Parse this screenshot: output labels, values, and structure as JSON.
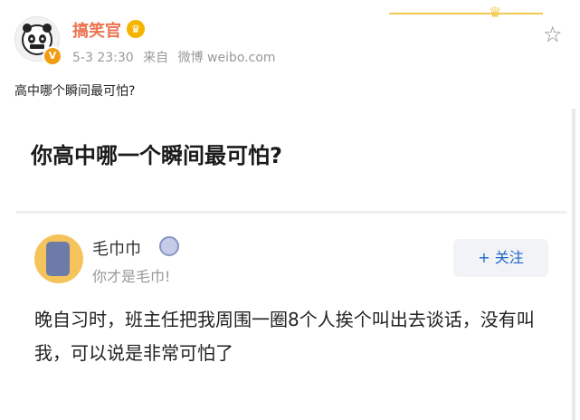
{
  "post": {
    "username": "搞笑官",
    "date": "5-3 23:30",
    "source_prefix": "来自",
    "source": "微博 weibo.com",
    "text": "高中哪个瞬间最可怕?"
  },
  "card": {
    "title": "你高中哪一个瞬间最可怕?",
    "answer": {
      "name": "毛巾巾",
      "bio": "你才是毛巾!",
      "follow_label": "+ 关注",
      "text": "晚自习时，班主任把我周围一圈8个人挨个叫出去谈话，没有叫我，可以说是非常可怕了"
    }
  },
  "icons": {
    "star": "star-icon",
    "verified": "verified-badge-icon",
    "crown": "crown-icon"
  },
  "colors": {
    "username": "#eb7350",
    "follow_text": "#1e66c9",
    "follow_bg": "#f2f3f7",
    "badge_orange": "#f39c12"
  }
}
